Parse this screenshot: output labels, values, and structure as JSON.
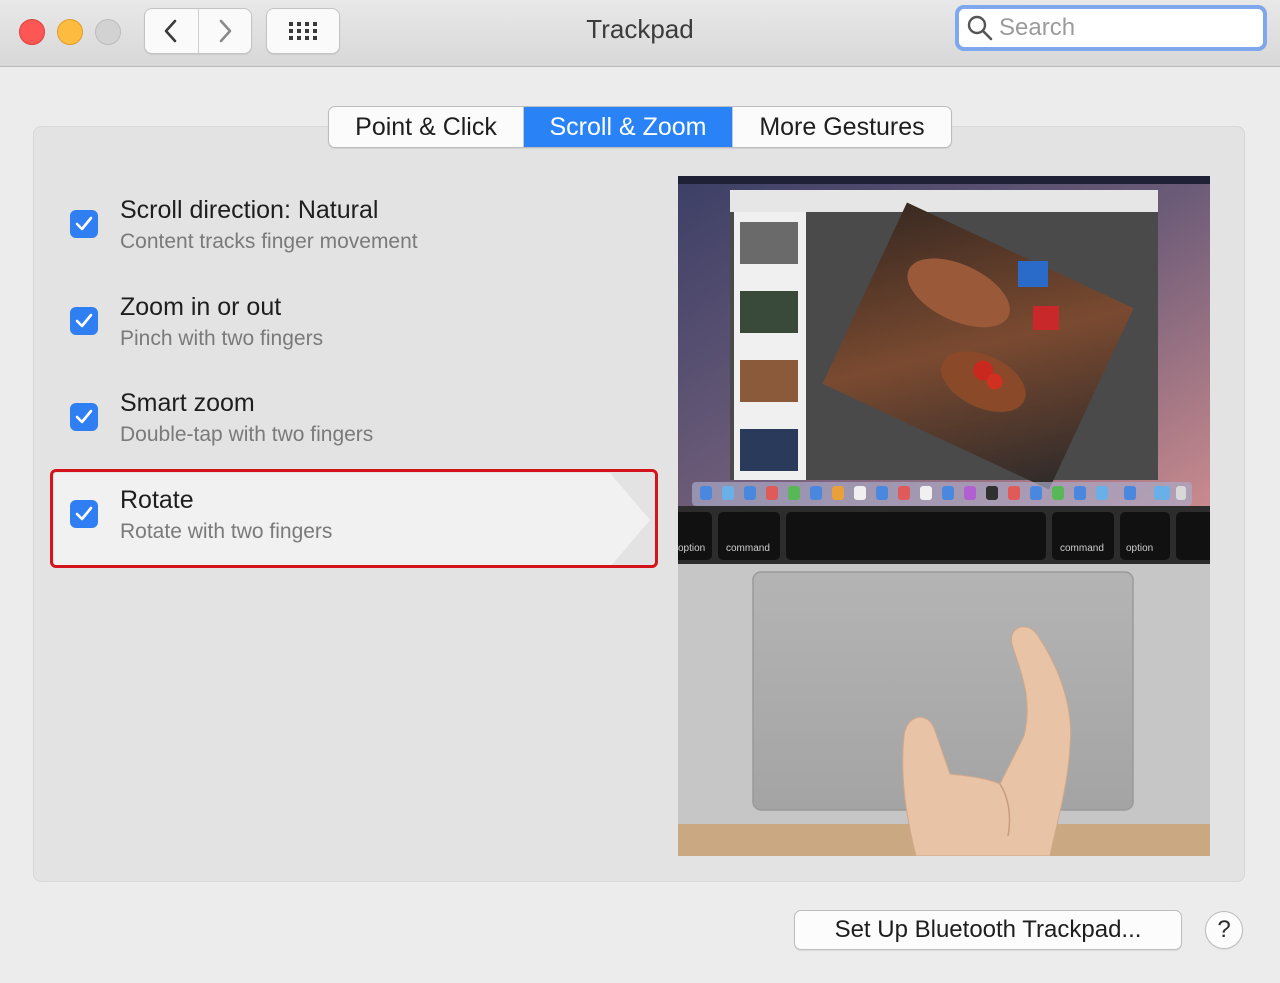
{
  "window": {
    "title": "Trackpad",
    "traffic_lights": [
      "close",
      "minimize",
      "zoom-disabled"
    ]
  },
  "toolbar": {
    "back_icon": "chevron-left-icon",
    "forward_icon": "chevron-right-icon",
    "grid_icon": "grid-icon"
  },
  "search": {
    "placeholder": "Search",
    "icon": "search-icon"
  },
  "tabs": [
    {
      "label": "Point & Click",
      "active": false
    },
    {
      "label": "Scroll & Zoom",
      "active": true
    },
    {
      "label": "More Gestures",
      "active": false
    }
  ],
  "options": [
    {
      "title": "Scroll direction: Natural",
      "description": "Content tracks finger movement",
      "checked": true
    },
    {
      "title": "Zoom in or out",
      "description": "Pinch with two fingers",
      "checked": true
    },
    {
      "title": "Smart zoom",
      "description": "Double-tap with two fingers",
      "checked": true
    },
    {
      "title": "Rotate",
      "description": "Rotate with two fingers",
      "checked": true,
      "selected": true
    }
  ],
  "preview": {
    "keys": [
      "option",
      "command",
      "command",
      "option"
    ]
  },
  "footer": {
    "setup_label": "Set Up Bluetooth Trackpad...",
    "help_label": "?"
  },
  "colors": {
    "accent": "#2a83f6",
    "highlight_border": "#d4141c",
    "close": "#fc5753",
    "minimize": "#fdbc40"
  }
}
